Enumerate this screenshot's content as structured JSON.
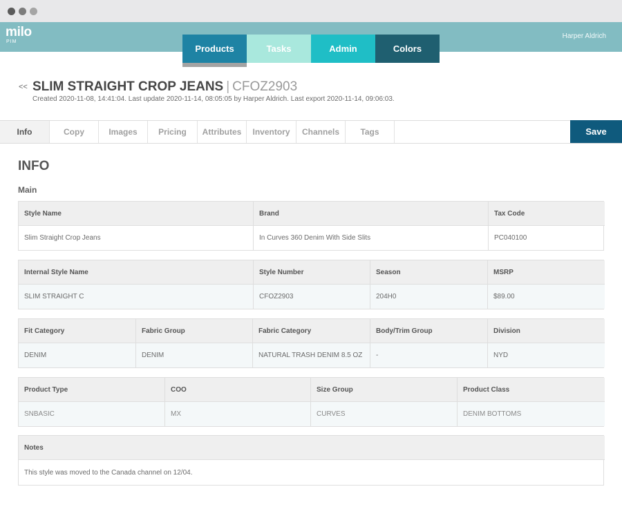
{
  "app": {
    "logo": "milo",
    "logo_sub": "PIM",
    "user": "Harper Aldrich"
  },
  "nav": {
    "products": "Products",
    "tasks": "Tasks",
    "admin": "Admin",
    "colors": "Colors",
    "active": "Products"
  },
  "header": {
    "back": "<<",
    "title": "SLIM STRAIGHT CROP JEANS",
    "separator": "|",
    "code": "CFOZ2903",
    "meta": "Created 2020-11-08, 14:41:04. Last update 2020-11-14, 08:05:05 by Harper Aldrich. Last export 2020-11-14, 09:06:03."
  },
  "tabs": {
    "info": "Info",
    "copy": "Copy",
    "images": "Images",
    "pricing": "Pricing",
    "attributes": "Attributes",
    "inventory": "Inventory",
    "channels": "Channels",
    "tags": "Tags",
    "active": "Info"
  },
  "save_label": "Save",
  "section": {
    "title": "INFO",
    "subtitle": "Main"
  },
  "row1": {
    "style_name": {
      "label": "Style Name",
      "value": "Slim Straight Crop Jeans"
    },
    "brand": {
      "label": "Brand",
      "value": "In Curves 360 Denim With Side Slits"
    },
    "tax_code": {
      "label": "Tax Code",
      "value": "PC040100"
    }
  },
  "row2": {
    "internal_style_name": {
      "label": "Internal Style Name",
      "value": "SLIM STRAIGHT C"
    },
    "style_number": {
      "label": "Style Number",
      "value": "CFOZ2903"
    },
    "season": {
      "label": "Season",
      "value": "204H0"
    },
    "msrp": {
      "label": "MSRP",
      "value": "$89.00"
    }
  },
  "row3": {
    "fit_category": {
      "label": "Fit Category",
      "value": "DENIM"
    },
    "fabric_group": {
      "label": "Fabric Group",
      "value": "DENIM"
    },
    "fabric_category": {
      "label": "Fabric Category",
      "value": "NATURAL TRASH DENIM 8.5 OZ"
    },
    "body_trim_group": {
      "label": "Body/Trim Group",
      "value": "-"
    },
    "division": {
      "label": "Division",
      "value": "NYD"
    }
  },
  "row4": {
    "product_type": {
      "label": "Product Type",
      "value": "SNBASIC"
    },
    "coo": {
      "label": "COO",
      "value": "MX"
    },
    "size_group": {
      "label": "Size Group",
      "value": "CURVES"
    },
    "product_class": {
      "label": "Product Class",
      "value": "DENIM BOTTOMS"
    }
  },
  "notes": {
    "label": "Notes",
    "value": "This style was moved to the Canada channel on 12/04."
  },
  "colors": {
    "appbar": "#82bcc2",
    "products": "#1e83a4",
    "tasks": "#a9e8dd",
    "admin": "#1fbec6",
    "colors": "#1f5f70",
    "save": "#0f5a7d"
  }
}
